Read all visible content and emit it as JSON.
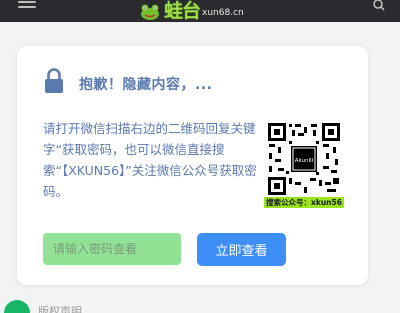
{
  "header": {
    "logo_text": "蛙台",
    "logo_domain": "xun68.cn",
    "menu_icon": "hamburger-menu-icon",
    "search_icon": "search-icon"
  },
  "card": {
    "lock_icon": "lock-icon",
    "title": "抱歉！隐藏内容，...",
    "description": "请打开微信扫描右边的二维码回复关键字“获取密码，也可以微信直接搜索“【XKUN56】”关注微信公众号获取密码。",
    "qr_center_label": "AkunIII",
    "qr_caption": "搜索公众号：xkun56",
    "input_placeholder": "请输入密码查看",
    "submit_label": "立即查看"
  },
  "footer": {
    "section_label": "版权声明"
  },
  "colors": {
    "topbar": "#2b2a2f",
    "title": "#5b7ab0",
    "input_bg": "#92e296",
    "button_bg": "#3e8ef7",
    "qr_caption_bg": "#9be31f"
  }
}
